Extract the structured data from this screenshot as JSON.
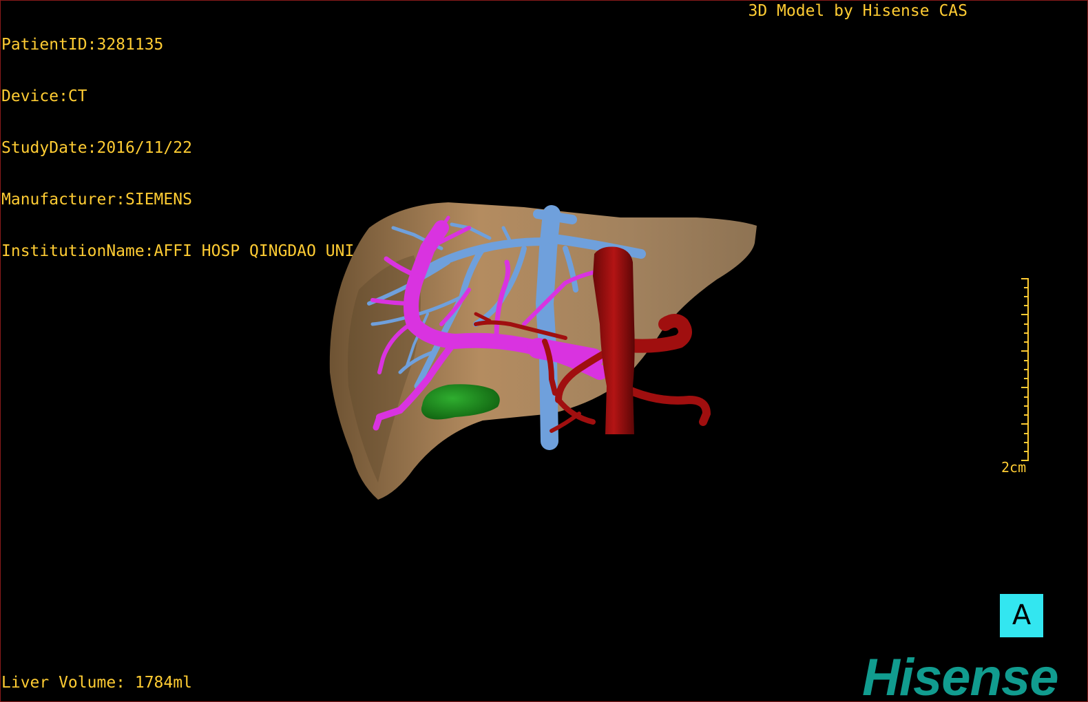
{
  "patient_info": {
    "patient_id": "PatientID:3281135",
    "device": "Device:CT",
    "study_date": "StudyDate:2016/11/22",
    "manufacturer": "Manufacturer:SIEMENS",
    "institution": "InstitutionName:AFFI HOSP QINGDAO UNI"
  },
  "credit": "3D Model by Hisense CAS",
  "liver_volume": "Liver Volume: 1784ml",
  "scale": {
    "label": "2cm"
  },
  "orientation": {
    "label": "A"
  },
  "brand": {
    "name": "Hisense",
    "color": "#119c8f"
  },
  "model": {
    "structures": [
      {
        "name": "liver",
        "color": "#b58d62"
      },
      {
        "name": "hepatic-vein",
        "color": "#6fa0dc"
      },
      {
        "name": "portal-vein",
        "color": "#d933e0"
      },
      {
        "name": "artery",
        "color": "#a00f0f"
      },
      {
        "name": "lesion",
        "color": "#1f8f1f"
      }
    ]
  },
  "text_color": "#ffcc33"
}
